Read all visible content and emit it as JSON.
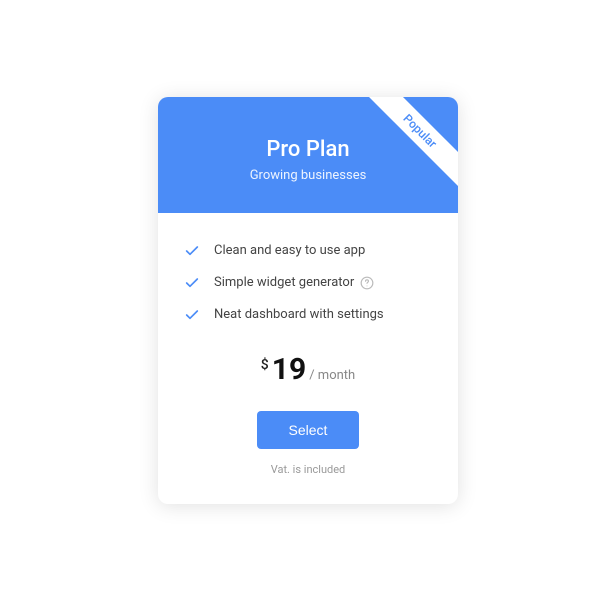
{
  "ribbon": "Popular",
  "plan": {
    "title": "Pro Plan",
    "subtitle": "Growing businesses"
  },
  "features": [
    {
      "label": "Clean and easy to use app",
      "help": false
    },
    {
      "label": "Simple widget generator",
      "help": true
    },
    {
      "label": "Neat dashboard with settings",
      "help": false
    }
  ],
  "price": {
    "currency": "$",
    "amount": "19",
    "period": "/ month"
  },
  "cta": "Select",
  "vat": "Vat. is included"
}
